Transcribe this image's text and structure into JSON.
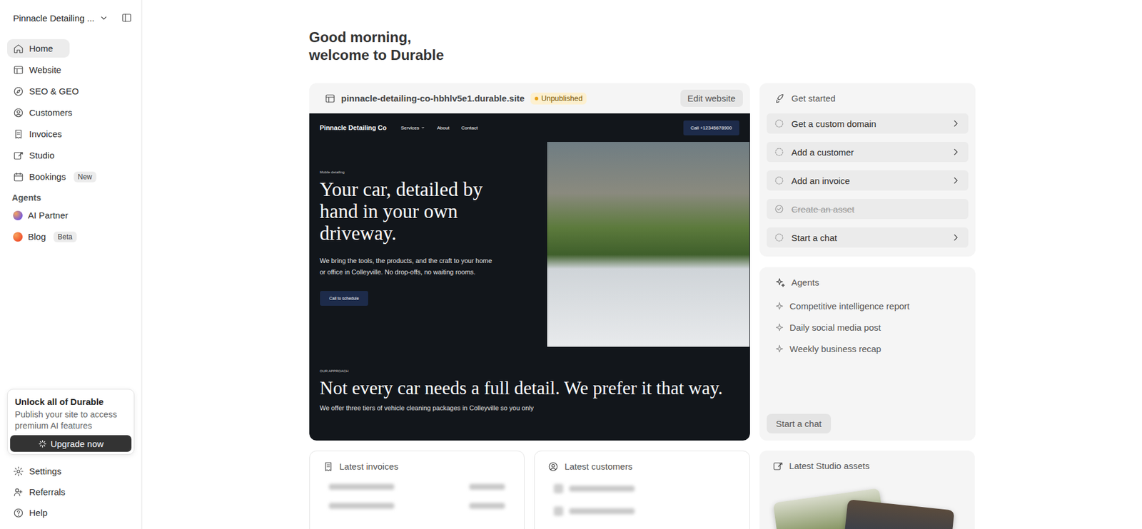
{
  "sidebar": {
    "workspace": "Pinnacle Detailing ...",
    "nav": [
      {
        "label": "Home",
        "selected": true
      },
      {
        "label": "Website",
        "selected": false
      },
      {
        "label": "SEO & GEO",
        "selected": false
      },
      {
        "label": "Customers",
        "selected": false
      },
      {
        "label": "Invoices",
        "selected": false
      },
      {
        "label": "Studio",
        "selected": false
      },
      {
        "label": "Bookings",
        "selected": false,
        "badge": "New"
      }
    ],
    "agents_label": "Agents",
    "agents": [
      {
        "label": "AI Partner",
        "color": "#7b5cd6"
      },
      {
        "label": "Blog",
        "badge": "Beta",
        "color": "#f0552f"
      }
    ],
    "upgrade": {
      "title": "Unlock all of Durable",
      "text": "Publish your site to access premium AI features",
      "button": "Upgrade now"
    },
    "footer": [
      {
        "label": "Settings"
      },
      {
        "label": "Referrals"
      },
      {
        "label": "Help"
      }
    ]
  },
  "greeting": {
    "line1": "Good morning,",
    "line2": "welcome to Durable"
  },
  "website_card": {
    "url": "pinnacle-detailing-co-hbhlv5e1.durable.site",
    "status": "Unpublished",
    "published": false,
    "edit_button": "Edit website",
    "preview": {
      "brand": "Pinnacle Detailing Co",
      "nav": [
        {
          "label": "Services",
          "has_menu": true
        },
        {
          "label": "About",
          "has_menu": false
        },
        {
          "label": "Contact",
          "has_menu": false
        }
      ],
      "call_button": "Call +12345678900",
      "eyebrow": "Mobile detailing",
      "headline": "Your car, detailed by hand in your own driveway.",
      "body": "We bring the tools, the products, and the craft to your home or office in Colleyville. No drop-offs, no waiting rooms.",
      "cta": "Call to schedule",
      "section_eyebrow": "OUR APPROACH",
      "section_headline": "Not every car needs a full detail. We prefer it that way.",
      "section_body": "We offer three tiers of vehicle cleaning packages in Colleyville so you only"
    }
  },
  "get_started": {
    "title": "Get started",
    "items": [
      {
        "label": "Get a custom domain",
        "done": false
      },
      {
        "label": "Add a customer",
        "done": false
      },
      {
        "label": "Add an invoice",
        "done": false
      },
      {
        "label": "Create an asset",
        "done": true
      },
      {
        "label": "Start a chat",
        "done": false
      }
    ]
  },
  "agents_card": {
    "title": "Agents",
    "items": [
      "Competitive intelligence report",
      "Daily social media post",
      "Weekly business recap"
    ],
    "button": "Start a chat"
  },
  "latest": [
    {
      "title": "Latest invoices",
      "kind": "invoices",
      "placeholder_rows": 2
    },
    {
      "title": "Latest customers",
      "kind": "customers",
      "placeholder_rows": 2
    },
    {
      "title": "Latest Studio assets",
      "kind": "assets",
      "placeholder_rows": 2
    }
  ]
}
